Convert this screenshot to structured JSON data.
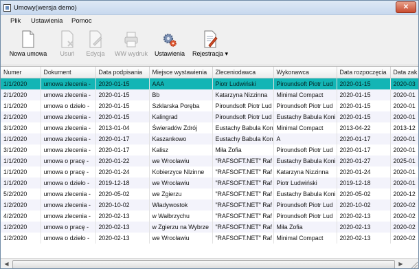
{
  "window": {
    "title": "Umowy(wersja demo)",
    "close_glyph": "✕"
  },
  "menu": [
    "Plik",
    "Ustawienia",
    "Pomoc"
  ],
  "toolbar": [
    {
      "label": "Nowa umowa",
      "icon": "document-new-icon",
      "enabled": true
    },
    {
      "label": "Usuń",
      "icon": "document-delete-icon",
      "enabled": false
    },
    {
      "label": "Edycja",
      "icon": "document-edit-icon",
      "enabled": false
    },
    {
      "label": "WW wydruk",
      "icon": "print-preview-icon",
      "enabled": false
    },
    {
      "label": "Ustawienia",
      "icon": "gears-icon",
      "enabled": true
    },
    {
      "label": "Rejestracja",
      "icon": "registration-icon",
      "enabled": true,
      "dropdown_glyph": "▾"
    }
  ],
  "grid": {
    "columns": [
      "Numer",
      "Dokument",
      "Data podpisania",
      "Miejsce wystawienia",
      "Zleceniodawca",
      "Wykonawca",
      "Data rozpoczęcia",
      "Data zak"
    ],
    "rows": [
      [
        "1/1/2020",
        "umowa zlecenia -",
        "2020-01-15",
        "AAA",
        "Piotr Ludwiński",
        "Piroundsoft Piotr Lud",
        "2020-01-15",
        "2020-03"
      ],
      [
        "2/1/2020",
        "umowa zlecenia -",
        "2020-01-15",
        "Bb",
        "Katarzyna Nizzinna",
        "Minimal Compact",
        "2020-01-15",
        "2020-01"
      ],
      [
        "1/1/2020",
        "umowa o dzieło -",
        "2020-01-15",
        "Szklarska Poręba",
        "Piroundsoft Piotr Lud",
        "Piroundsoft Piotr Lud",
        "2020-01-15",
        "2020-01"
      ],
      [
        "2/1/2020",
        "umowa zlecenia -",
        "2020-01-15",
        "Kalingrad",
        "Piroundsoft Piotr Lud",
        "Eustachy Babula Koni",
        "2020-01-15",
        "2020-01"
      ],
      [
        "3/1/2020",
        "umowa zlecenia -",
        "2013-01-04",
        "Świeradów Zdrój",
        "Eustachy Babula Koni",
        "Minimal Compact",
        "2013-04-22",
        "2013-12"
      ],
      [
        "1/1/2020",
        "umowa zlecenia -",
        "2020-01-17",
        "Kaszankowo",
        "Eustachy Babula Koni",
        "A",
        "2020-01-17",
        "2020-01"
      ],
      [
        "3/1/2020",
        "umowa zlecenia -",
        "2020-01-17",
        "Kalisz",
        "Miła Zofia",
        "Piroundsoft Piotr Lud",
        "2020-01-17",
        "2020-01"
      ],
      [
        "1/1/2020",
        "umowa o pracę -",
        "2020-01-22",
        "we Wrocławiu",
        "\"RAFSOFT.NET\" Raf",
        "Eustachy Babula Koni",
        "2020-01-27",
        "2025-01"
      ],
      [
        "1/1/2020",
        "umowa o pracę -",
        "2020-01-24",
        "Kobierzyce NIzinne",
        "\"RAFSOFT.NET\" Raf",
        "Katarzyna Nizzinna",
        "2020-01-24",
        "2020-01"
      ],
      [
        "1/1/2020",
        "umowa o dzieło -",
        "2019-12-18",
        "we Wrocławiu",
        "\"RAFSOFT.NET\" Raf",
        "Piotr Ludwiński",
        "2019-12-18",
        "2020-01"
      ],
      [
        "5/2/2020",
        "umowa zlecenia -",
        "2020-05-02",
        "we Zgierzu",
        "\"RAFSOFT.NET\" Raf",
        "Eustachy Babula Koni",
        "2020-05-02",
        "2020-12"
      ],
      [
        "1/2/2020",
        "umowa zlecenia -",
        "2020-10-02",
        "Władywostok",
        "\"RAFSOFT.NET\" Raf",
        "Piroundsoft Piotr Lud",
        "2020-10-02",
        "2020-02"
      ],
      [
        "4/2/2020",
        "umowa zlecenia -",
        "2020-02-13",
        "w Wałbrzychu",
        "\"RAFSOFT.NET\" Raf",
        "Piroundsoft Piotr Lud",
        "2020-02-13",
        "2020-02"
      ],
      [
        "1/2/2020",
        "umowa o pracę -",
        "2020-02-13",
        "w Zgierzu na Wybrze",
        "\"RAFSOFT.NET\" Raf",
        "Miła Zofia",
        "2020-02-13",
        "2020-02"
      ],
      [
        "1/2/2020",
        "umowa o dzieło -",
        "2020-02-13",
        "we Wrocławiu",
        "\"RAFSOFT.NET\" Raf",
        "Minimal Compact",
        "2020-02-13",
        "2020-02"
      ]
    ],
    "selected_row_index": 0,
    "colors": {
      "selected": "#13b5b5",
      "alt_row": "#f3f3fb"
    }
  },
  "scrollbar": {
    "left_glyph": "◀",
    "right_glyph": "▶"
  }
}
